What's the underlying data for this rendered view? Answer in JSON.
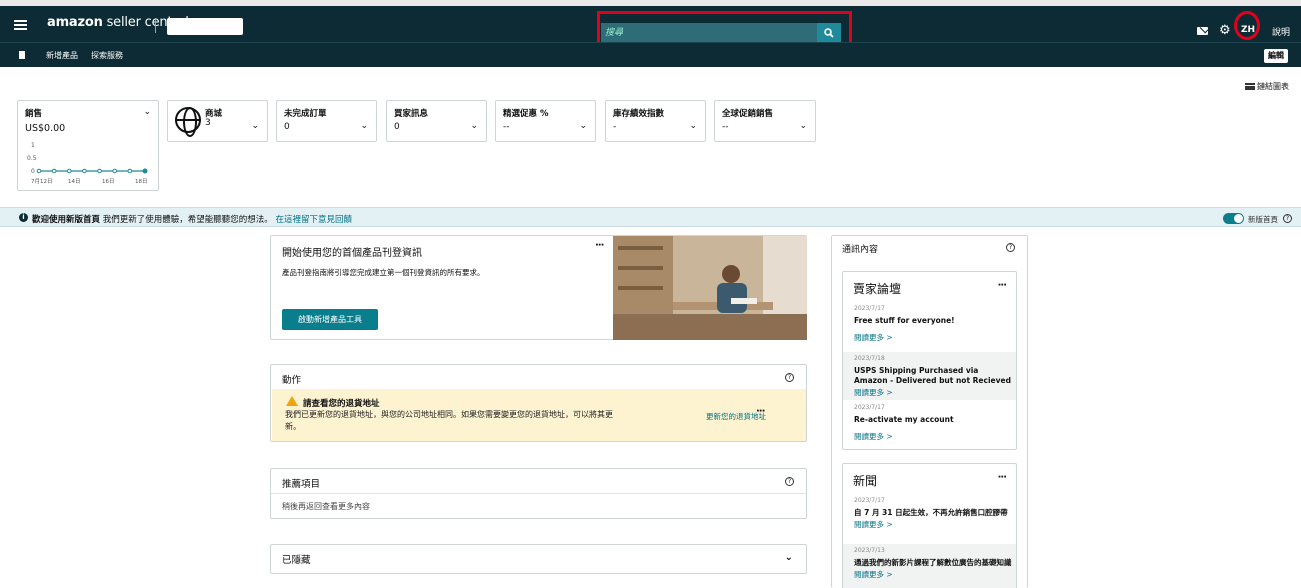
{
  "header": {
    "logo_brand": "amazon",
    "logo_product": " seller central",
    "search_placeholder": "搜尋",
    "user_initials": "ZH",
    "help_label": "說明"
  },
  "subnav": {
    "links": [
      "新增產品",
      "探索服務"
    ],
    "edit_label": "編輯"
  },
  "toolbar": {
    "link_graph_label": "鏈結圖表"
  },
  "metrics": {
    "sales": {
      "title": "銷售",
      "value": "US$0.00",
      "y_ticks": [
        "1",
        "0.5",
        "0"
      ],
      "x_ticks": [
        "7月12日",
        "14日",
        "16日",
        "18日"
      ],
      "points": [
        0,
        0,
        0,
        0,
        0,
        0,
        0,
        0
      ]
    },
    "marketplace": {
      "title": "商城",
      "value": "3"
    },
    "open_orders": {
      "title": "未完成訂單",
      "value": "0"
    },
    "buyer_messages": {
      "title": "買家訊息",
      "value": "0"
    },
    "featured_offer": {
      "title": "精選促惠 %",
      "value": "--"
    },
    "inventory_index": {
      "title": "庫存績效指數",
      "value": "-"
    },
    "global_promotions": {
      "title": "全球促銷銷售",
      "value": "--"
    }
  },
  "banner": {
    "bold_text": "歡迎使用新版首頁",
    "text": " 我們更新了使用體驗，希望能聽聽您的想法。",
    "link": "在這裡留下意見回饋",
    "toggle_label": "新版首頁"
  },
  "onboarding": {
    "title": "開始使用您的首個產品刊登資訊",
    "description": "產品刊登指南將引導您完成建立第一個刊登資訊的所有要求。",
    "button": "啟動新增產品工具"
  },
  "actions": {
    "title": "動作",
    "alert_title": "請查看您的退貨地址",
    "alert_desc": "我們已更新您的退貨地址，與您的公司地址相同。如果您需要變更您的退貨地址，可以將其更新。",
    "alert_link": "更新您的退貨地址"
  },
  "recommendations": {
    "title": "推薦項目",
    "subtitle": "稍後再返回查看更多內容"
  },
  "hidden_section": {
    "title": "已隱藏"
  },
  "communications": {
    "title": "通訊內容",
    "forum": {
      "title": "賣家論壇",
      "posts": [
        {
          "date": "2023/7/17",
          "title": "Free stuff for everyone!",
          "more": "閱讀更多 >"
        },
        {
          "date": "2023/7/18",
          "title": "USPS Shipping Purchased via Amazon - Delivered but not Recieved",
          "more": "閱讀更多 >"
        },
        {
          "date": "2023/7/17",
          "title": "Re-activate my account",
          "more": "閱讀更多 >"
        }
      ]
    },
    "news": {
      "title": "新聞",
      "posts": [
        {
          "date": "2023/7/17",
          "title": "自 7 月 31 日起生效，不再允許銷售口腔膠帶",
          "more": "閱讀更多 >"
        },
        {
          "date": "2023/7/13",
          "title": "通過我們的新影片課程了解數位廣告的基礎知識",
          "more": "閱讀更多 >"
        }
      ]
    }
  }
}
